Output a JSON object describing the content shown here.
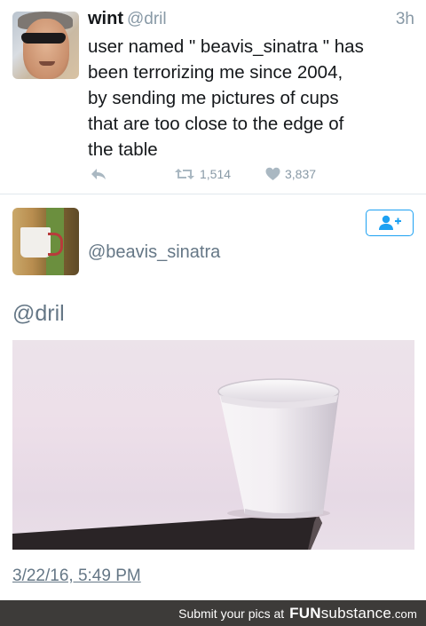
{
  "tweet": {
    "display_name": "wint",
    "handle": "@dril",
    "time": "3h",
    "text": "user named \" beavis_sinatra \" has\nbeen terrorizing me since 2004,\nby sending me pictures of cups\nthat are too close to the edge of\nthe table",
    "retweets": "1,514",
    "likes": "3,837",
    "avatar_icon": "sunglasses-man-avatar"
  },
  "reply_tweet": {
    "handle": "@beavis_sinatra",
    "mention": "@dril",
    "timestamp": "3/22/16, 5:49 PM",
    "avatar_icon": "mug-avatar",
    "photo_icon": "foam-cup-on-table-edge"
  },
  "follow_button": {
    "icon": "add-user-icon"
  },
  "footer": {
    "submit_text": "Submit your pics at",
    "brand_bold": "FUN",
    "brand_rest": "substance",
    "brand_tld": ".com"
  },
  "colors": {
    "accent": "#1da1f2",
    "muted": "#8899a6",
    "footer_bg": "#3d3b39"
  }
}
